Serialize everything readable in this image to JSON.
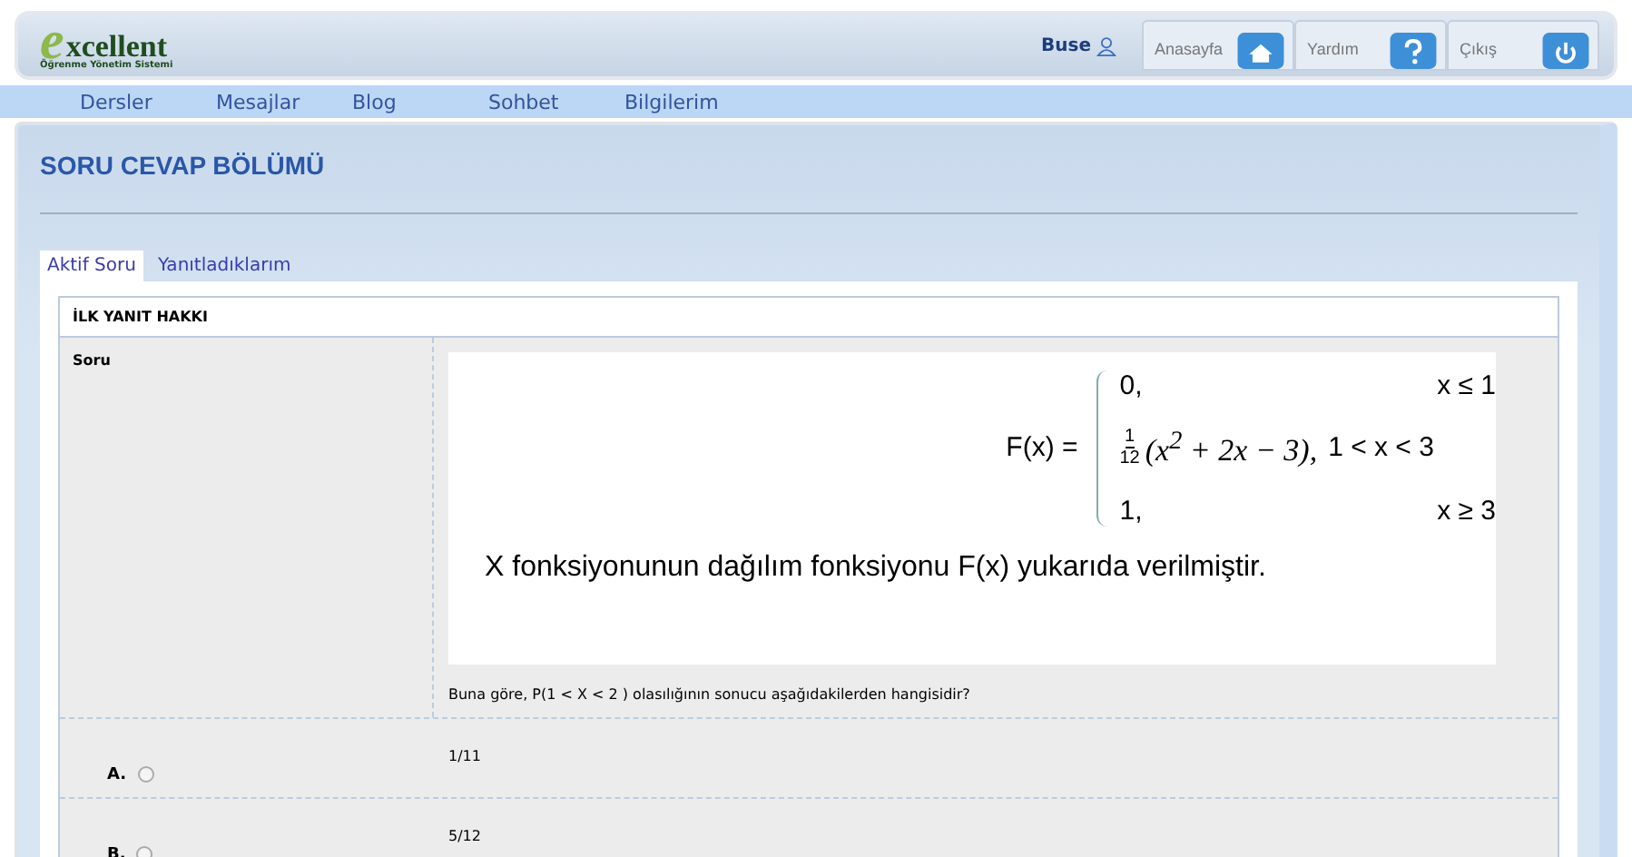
{
  "logo": {
    "initial": "e",
    "name": "xcellent",
    "tagline": "Öğrenme Yönetim Sistemi"
  },
  "user": {
    "name": "Buse"
  },
  "header_buttons": [
    {
      "label": "Anasayfa",
      "kind": "home"
    },
    {
      "label": "Yardım",
      "kind": "help"
    },
    {
      "label": "Çıkış",
      "kind": "power"
    }
  ],
  "nav": [
    "Dersler",
    "Mesajlar",
    "Blog",
    "Sohbet",
    "Bilgilerim"
  ],
  "page_title": "SORU CEVAP BÖLÜMÜ",
  "tabs": [
    {
      "label": "Aktif Soru",
      "selected": true
    },
    {
      "label": "Yanıtladıklarım",
      "selected": false
    }
  ],
  "panel": {
    "title": "İLK YANIT HAKKI",
    "question_label": "Soru",
    "formula": {
      "lhs": "F(x) =",
      "cases": [
        {
          "value": "0,",
          "condition": "x ≤ 1"
        },
        {
          "numerator": "1",
          "denominator": "12",
          "value": "(x$^{2}$ + 2x − 3),",
          "condition": "1 < x < 3"
        },
        {
          "value": "1,",
          "condition": "x ≥ 3"
        }
      ],
      "caption": "X fonksiyonunun dağılım fonksiyonu F(x) yukarıda verilmiştir."
    },
    "question": "Buna göre, P(1 < X < 2 ) olasılığının sonucu aşağıdakilerden hangisidir?",
    "options": [
      {
        "letter": "A.",
        "text": "1/11",
        "selected": false
      },
      {
        "letter": "B.",
        "text": "5/12",
        "selected": false
      }
    ]
  }
}
